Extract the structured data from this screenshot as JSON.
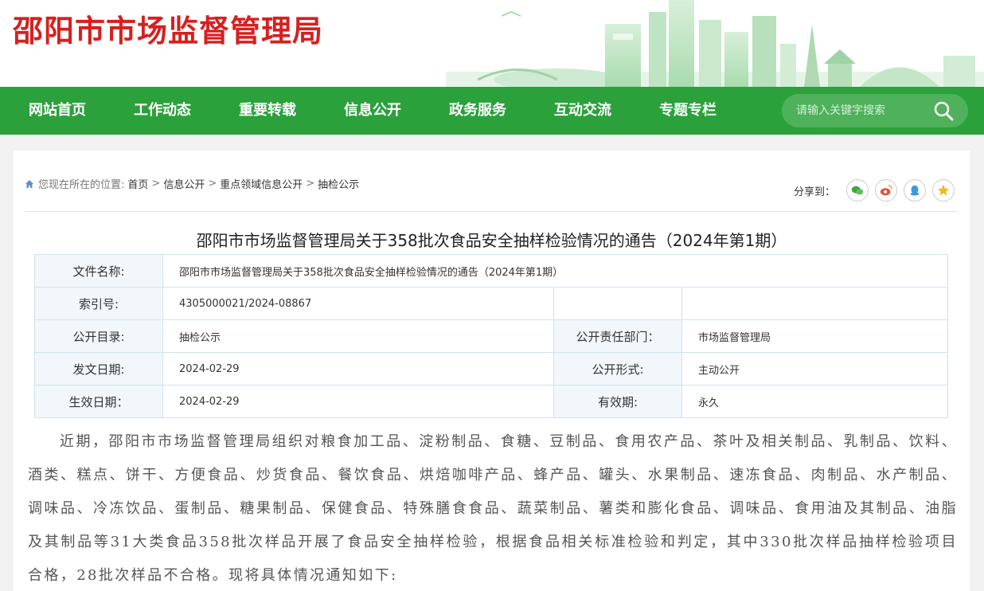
{
  "header": {
    "site_title": "邵阳市市场监督管理局"
  },
  "nav": {
    "items": [
      "网站首页",
      "工作动态",
      "重要转载",
      "信息公开",
      "政务服务",
      "互动交流",
      "专题专栏"
    ],
    "search_placeholder": "请输入关键字搜索",
    "icons": {
      "search": "search-icon"
    }
  },
  "breadcrumb": {
    "prefix": "您现在所在的位置:",
    "items": [
      "首页",
      "信息公开",
      "重点领域信息公开",
      "抽检公示"
    ],
    "separator": ">"
  },
  "share": {
    "label": "分享到：",
    "buttons": [
      "wechat-icon",
      "weibo-icon",
      "qq-icon",
      "qzone-icon"
    ]
  },
  "article": {
    "title": "邵阳市市场监督管理局关于358批次食品安全抽样检验情况的通告（2024年第1期）",
    "meta": {
      "file_name_label": "文件名称:",
      "file_name": "邵阳市市场监督管理局关于358批次食品安全抽样检验情况的通告（2024年第1期）",
      "index_label": "索引号:",
      "index": "4305000021/2024-08867",
      "catalog_label": "公开目录:",
      "catalog": "抽检公示",
      "dept_label": "公开责任部门：",
      "dept": "市场监督管理局",
      "issue_date_label": "发文日期:",
      "issue_date": "2024-02-29",
      "form_label": "公开形式:",
      "form": "主动公开",
      "effective_date_label": "生效日期：",
      "effective_date": "2024-02-29",
      "validity_label": "有效期:",
      "validity": "永久"
    },
    "body": "近期，邵阳市市场监督管理局组织对粮食加工品、淀粉制品、食糖、豆制品、食用农产品、茶叶及相关制品、乳制品、饮料、酒类、糕点、饼干、方便食品、炒货食品、餐饮食品、烘焙咖啡产品、蜂产品、罐头、水果制品、速冻食品、肉制品、水产制品、调味品、冷冻饮品、蛋制品、糖果制品、保健食品、特殊膳食食品、蔬菜制品、薯类和膨化食品、调味品、食用油及其制品、油脂及其制品等31大类食品358批次样品开展了食品安全抽样检验，根据食品相关标准检验和判定，其中330批次样品抽样检验项目合格，28批次样品不合格。现将具体情况通知如下:"
  },
  "colors": {
    "brand_red": "#d6201f",
    "nav_green": "#2ba13c",
    "table_border": "#cfe3ef"
  }
}
